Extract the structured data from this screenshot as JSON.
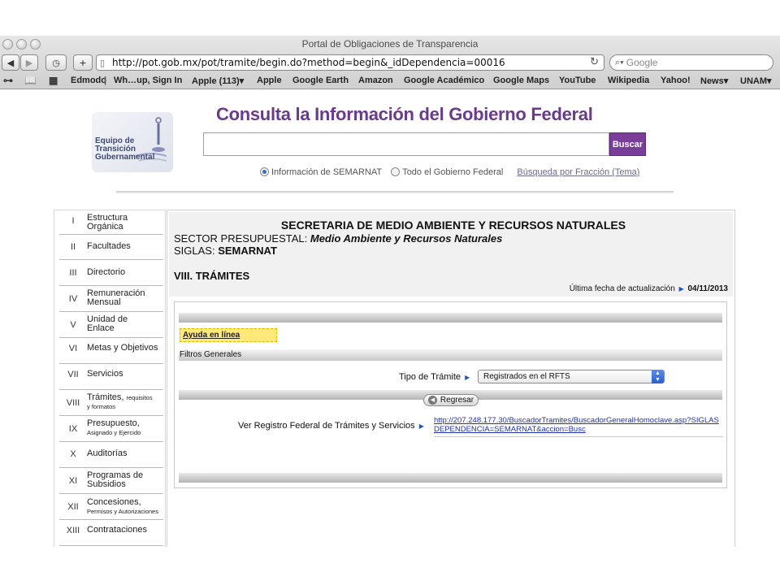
{
  "browser": {
    "window_title": "Portal de Obligaciones de Transparencia",
    "url": "http://pot.gob.mx/pot/tramite/begin.do?method=begin&_idDependencia=00016",
    "search_placeholder": "Google",
    "bookmarks": [
      "Edmodo",
      "Wh…up, Sign In",
      "Apple (113)▾",
      "Apple",
      "Google Earth",
      "Amazon",
      "Google Académico",
      "Google Maps",
      "YouTube",
      "Wikipedia",
      "Yahoo!",
      "News▾",
      "UNAM▾"
    ]
  },
  "header": {
    "title": "Consulta la Información del Gobierno Federal",
    "logo_lines": [
      "Equipo de",
      "Transición",
      "Gubernamental"
    ],
    "search_button": "Buscar",
    "radio_semarnat": "Información de SEMARNAT",
    "radio_todo": "Todo el Gobierno Federal",
    "fraccion_link": "Búsqueda por Fracción (Tema)"
  },
  "sidebar": {
    "items": [
      {
        "num": "I",
        "label": "Estructura",
        "label2": "Orgánica",
        "small": ""
      },
      {
        "num": "II",
        "label": "Facultades",
        "label2": "",
        "small": ""
      },
      {
        "num": "III",
        "label": "Directorio",
        "label2": "",
        "small": ""
      },
      {
        "num": "IV",
        "label": "Remuneración",
        "label2": "Mensual",
        "small": ""
      },
      {
        "num": "V",
        "label": "Unidad de",
        "label2": "Enlace",
        "small": ""
      },
      {
        "num": "VI",
        "label": "Metas y Objetivos",
        "label2": "",
        "small": ""
      },
      {
        "num": "VII",
        "label": "Servicios",
        "label2": "",
        "small": ""
      },
      {
        "num": "VIII",
        "label": "Trámites,",
        "label2": "y formatos",
        "small": "requisitos"
      },
      {
        "num": "IX",
        "label": "Presupuesto,",
        "label2": "Asignado y Ejercido",
        "small": ""
      },
      {
        "num": "X",
        "label": "Auditorías",
        "label2": "",
        "small": ""
      },
      {
        "num": "XI",
        "label": "Programas de",
        "label2": "Subsidios",
        "small": ""
      },
      {
        "num": "XII",
        "label": "Concesiones,",
        "label2": "Permisos y Autorizaciones",
        "small": ""
      },
      {
        "num": "XIII",
        "label": "Contrataciones",
        "label2": "",
        "small": ""
      }
    ]
  },
  "main": {
    "secretaria": "SECRETARIA DE MEDIO AMBIENTE Y RECURSOS NATURALES",
    "sector_label": "SECTOR PRESUPUESTAL:",
    "sector_value": "Medio Ambiente y Recursos Naturales",
    "siglas_label": "SIGLAS:",
    "siglas_value": "SEMARNAT",
    "section_title": "VIII. TRÁMITES",
    "update_label": "Última fecha de actualización",
    "update_date": "04/11/2013",
    "ayuda": "Ayuda en línea",
    "filtros": "Filtros Generales",
    "tipo_label": "Tipo de Trámite",
    "tipo_value": "Registrados en el RFTS",
    "regresar": "Regresar",
    "registro_label": "Ver Registro Federal de Trámites y Servicios",
    "registro_link": "http://207.248.177.30/BuscadorTramites/BuscadorGeneralHomoclave.asp?SIGLASDEPENDENCIA=SEMARNAT&accion=Busc"
  }
}
